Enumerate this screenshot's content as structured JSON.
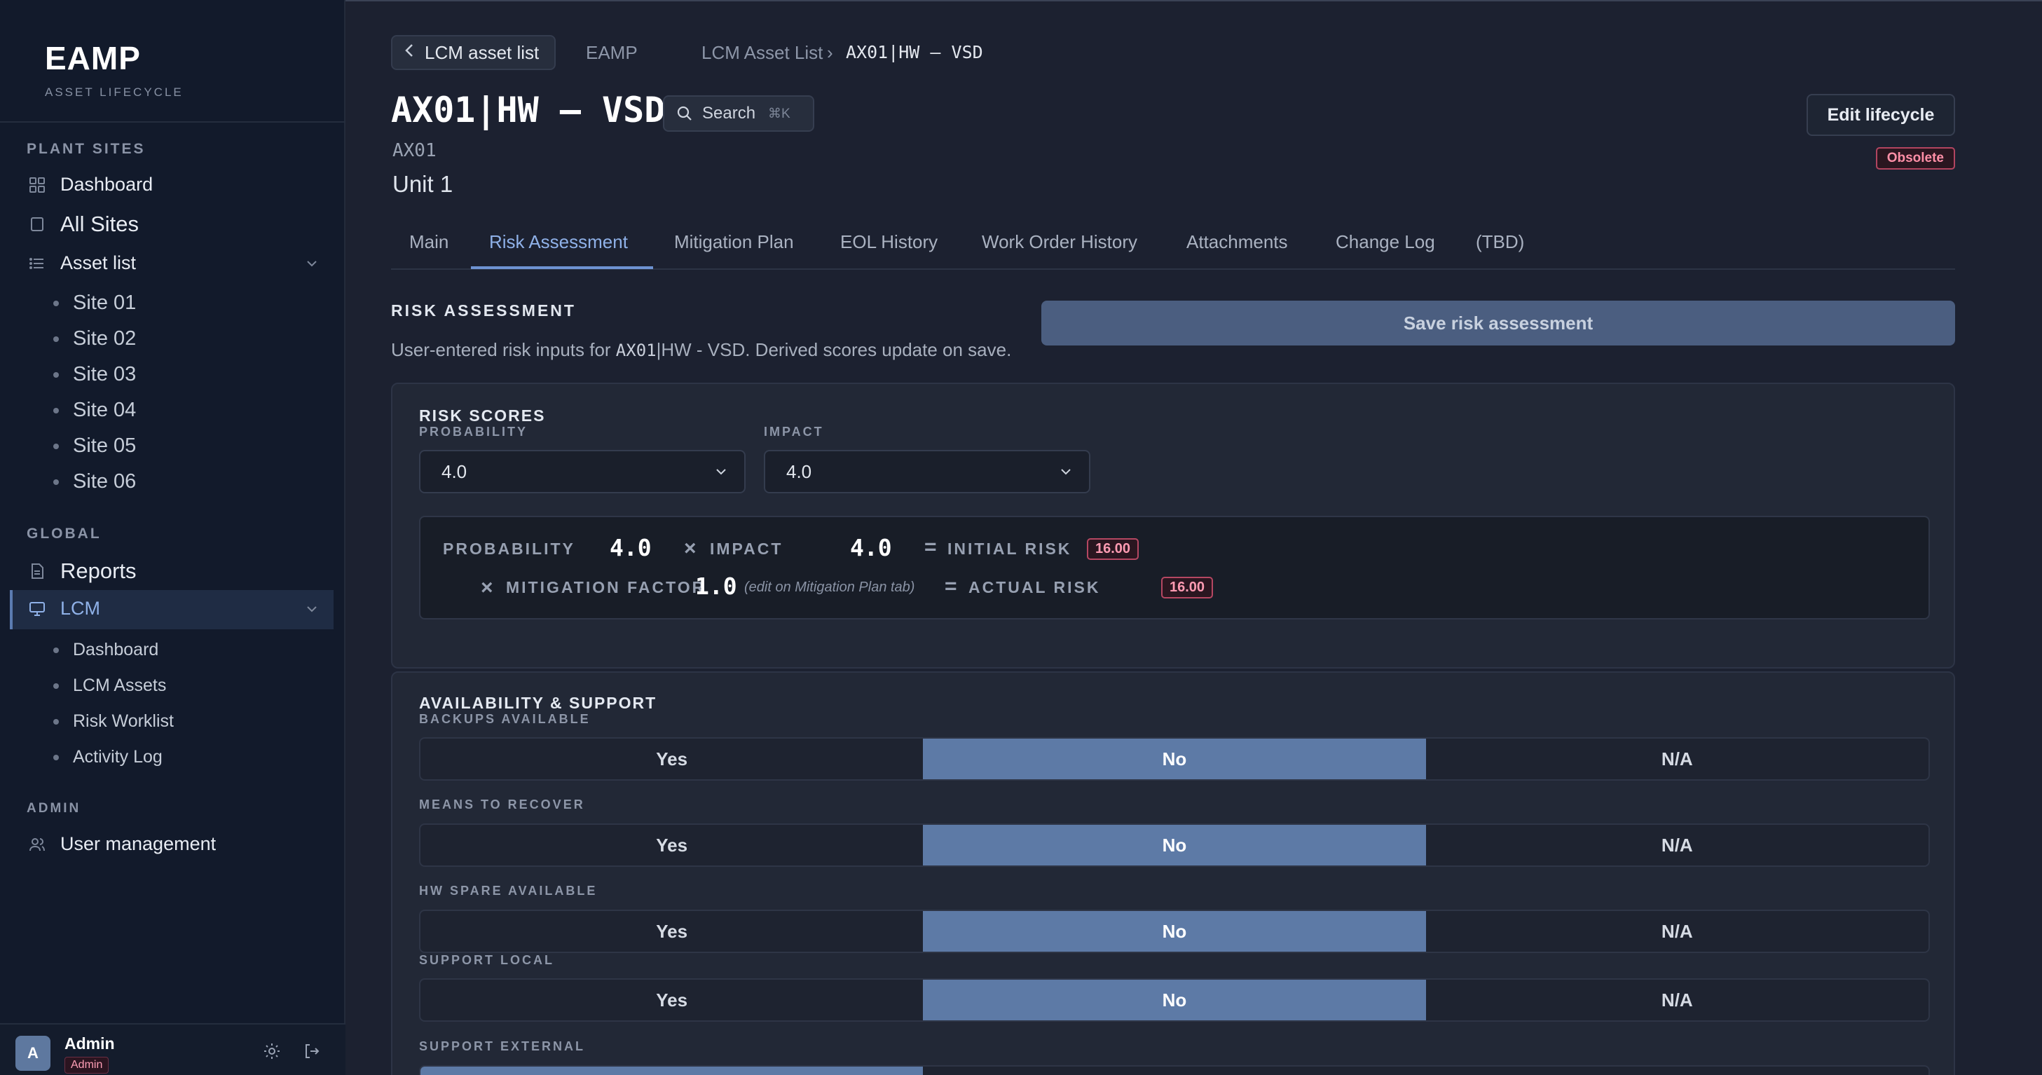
{
  "sidebar": {
    "brand_title": "EAMP",
    "brand_subtitle": "ASSET LIFECYCLE",
    "section_plant_sites": "PLANT SITES",
    "dashboard": "Dashboard",
    "all_sites": "All Sites",
    "asset_list": "Asset list",
    "sites": [
      "Site 01",
      "Site 02",
      "Site 03",
      "Site 04",
      "Site 05",
      "Site 06"
    ],
    "section_global": "GLOBAL",
    "reports": "Reports",
    "lcm": "LCM",
    "lcm_items": [
      "Dashboard",
      "LCM Assets",
      "Risk Worklist",
      "Activity Log"
    ],
    "section_admin": "ADMIN",
    "user_management": "User management",
    "user": {
      "initial": "A",
      "name": "Admin",
      "role": "Admin"
    }
  },
  "header": {
    "back_label": "LCM asset list",
    "crumb_root": "EAMP",
    "crumb_list": "LCM Asset List",
    "crumb_sep": "›",
    "crumb_current": "AX01|HW – VSD",
    "title": "AX01|HW – VSD",
    "search_label": "Search",
    "search_shortcut": "⌘K",
    "code": "AX01",
    "unit": "Unit 1",
    "edit_label": "Edit lifecycle",
    "status_badge": "Obsolete"
  },
  "tabs": [
    "Main",
    "Risk Assessment",
    "Mitigation Plan",
    "EOL History",
    "Work Order History",
    "Attachments",
    "Change Log",
    "(TBD)"
  ],
  "active_tab": "Risk Assessment",
  "risk_assessment": {
    "heading": "RISK ASSESSMENT",
    "desc_before": "User-entered risk inputs for ",
    "desc_code": "AX01",
    "desc_after": "|HW - VSD. Derived scores update on save.",
    "save_label": "Save risk assessment"
  },
  "risk_scores": {
    "title": "RISK SCORES",
    "probability_label": "PROBABILITY",
    "probability_value": "4.0",
    "impact_label": "IMPACT",
    "impact_value": "4.0",
    "formula": {
      "probability_label": "PROBABILITY",
      "probability": "4.0",
      "times": "×",
      "impact_label": "IMPACT",
      "impact": "4.0",
      "equals": "=",
      "initial_risk_label": "INITIAL RISK",
      "initial_risk": "16.00",
      "mitigation_label": "MITIGATION FACTOR",
      "mitigation": "1.0",
      "mitigation_note": "(edit on Mitigation Plan tab)",
      "actual_risk_label": "ACTUAL RISK",
      "actual_risk": "16.00"
    }
  },
  "availability": {
    "title": "AVAILABILITY & SUPPORT",
    "options": [
      "Yes",
      "No",
      "N/A"
    ],
    "fields": [
      {
        "label": "BACKUPS AVAILABLE",
        "selected": "No"
      },
      {
        "label": "MEANS TO RECOVER",
        "selected": "No"
      },
      {
        "label": "HW SPARE AVAILABLE",
        "selected": "No"
      },
      {
        "label": "SUPPORT LOCAL",
        "selected": "No"
      },
      {
        "label": "SUPPORT EXTERNAL",
        "selected": "Yes"
      }
    ]
  },
  "colors": {
    "accent": "#6e93d2",
    "selected_segment": "#5d7aa6",
    "danger": "#b54762"
  }
}
